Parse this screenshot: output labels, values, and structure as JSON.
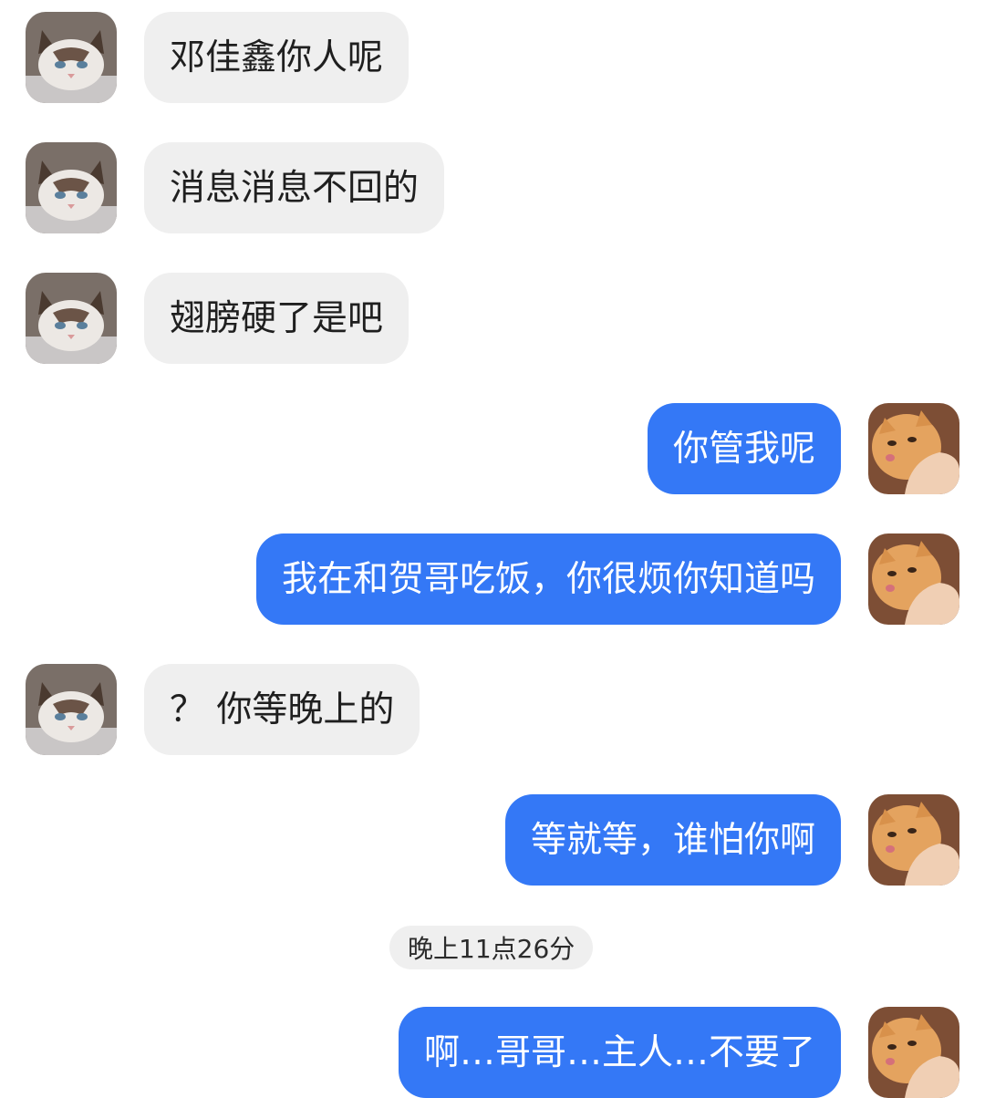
{
  "chat": {
    "messages": [
      {
        "side": "in",
        "text": "邓佳鑫你人呢"
      },
      {
        "side": "in",
        "text": "消息消息不回的"
      },
      {
        "side": "in",
        "text": "翅膀硬了是吧"
      },
      {
        "side": "out",
        "text": "你管我呢"
      },
      {
        "side": "out",
        "text": "我在和贺哥吃饭，你很烦你知道吗"
      },
      {
        "side": "in",
        "text": "？ 你等晚上的"
      },
      {
        "side": "out",
        "text": "等就等，谁怕你啊"
      },
      {
        "side": "out",
        "text": "啊…哥哥…主人…不要了"
      }
    ],
    "timestamp": "晚上11点26分"
  },
  "avatars": {
    "contact": "cat-avatar-icon",
    "self": "orange-cat-avatar-icon"
  },
  "colors": {
    "incoming_bubble": "#efefef",
    "outgoing_bubble": "#3478f6",
    "background": "#ffffff"
  }
}
